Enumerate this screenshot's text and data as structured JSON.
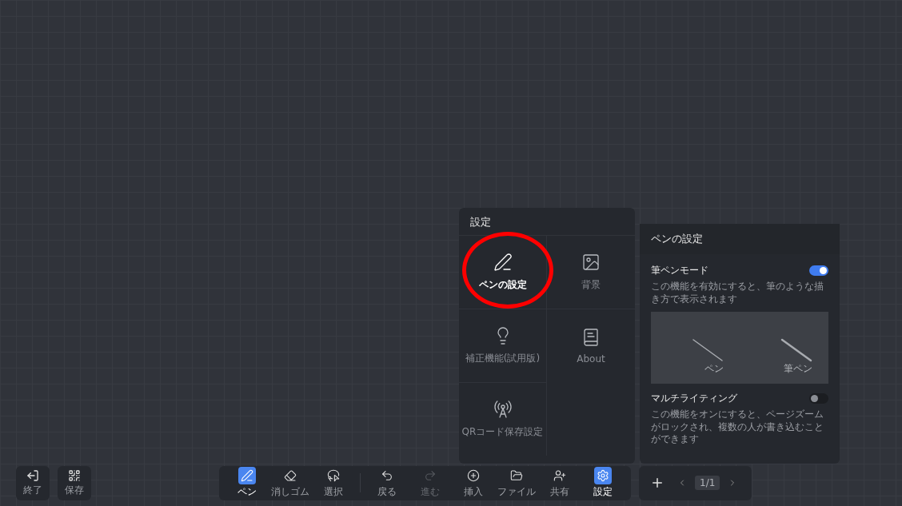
{
  "settings_menu": {
    "title": "設定",
    "items": [
      {
        "label": "ペンの設定",
        "selected": true
      },
      {
        "label": "背景",
        "selected": false
      },
      {
        "label": "補正機能(試用版)",
        "selected": false
      },
      {
        "label": "About",
        "selected": false
      },
      {
        "label": "QRコード保存設定",
        "selected": false
      }
    ]
  },
  "pen_settings": {
    "title": "ペンの設定",
    "options": [
      {
        "label": "筆ペンモード",
        "on": true,
        "description": "この機能を有効にすると、筆のような描き方で表示されます",
        "preview_labels": [
          "ペン",
          "筆ペン"
        ]
      },
      {
        "label": "マルチライティング",
        "on": false,
        "description": "この機能をオンにすると、ページズームがロックされ、複数の人が書き込むことができます"
      }
    ]
  },
  "left_buttons": [
    {
      "label": "終了"
    },
    {
      "label": "保存"
    }
  ],
  "toolbar": {
    "groups": [
      [
        {
          "label": "ペン",
          "selected": true,
          "disabled": false
        },
        {
          "label": "消しゴム",
          "selected": false,
          "disabled": false
        },
        {
          "label": "選択",
          "selected": false,
          "disabled": false
        }
      ],
      [
        {
          "label": "戻る",
          "selected": false,
          "disabled": false
        },
        {
          "label": "進む",
          "selected": false,
          "disabled": true
        },
        {
          "label": "挿入",
          "selected": false,
          "disabled": false
        },
        {
          "label": "ファイル",
          "selected": false,
          "disabled": false
        },
        {
          "label": "共有",
          "selected": false,
          "disabled": false
        },
        {
          "label": "設定",
          "selected": true,
          "disabled": false
        }
      ]
    ]
  },
  "pager": {
    "page": "1/1"
  }
}
